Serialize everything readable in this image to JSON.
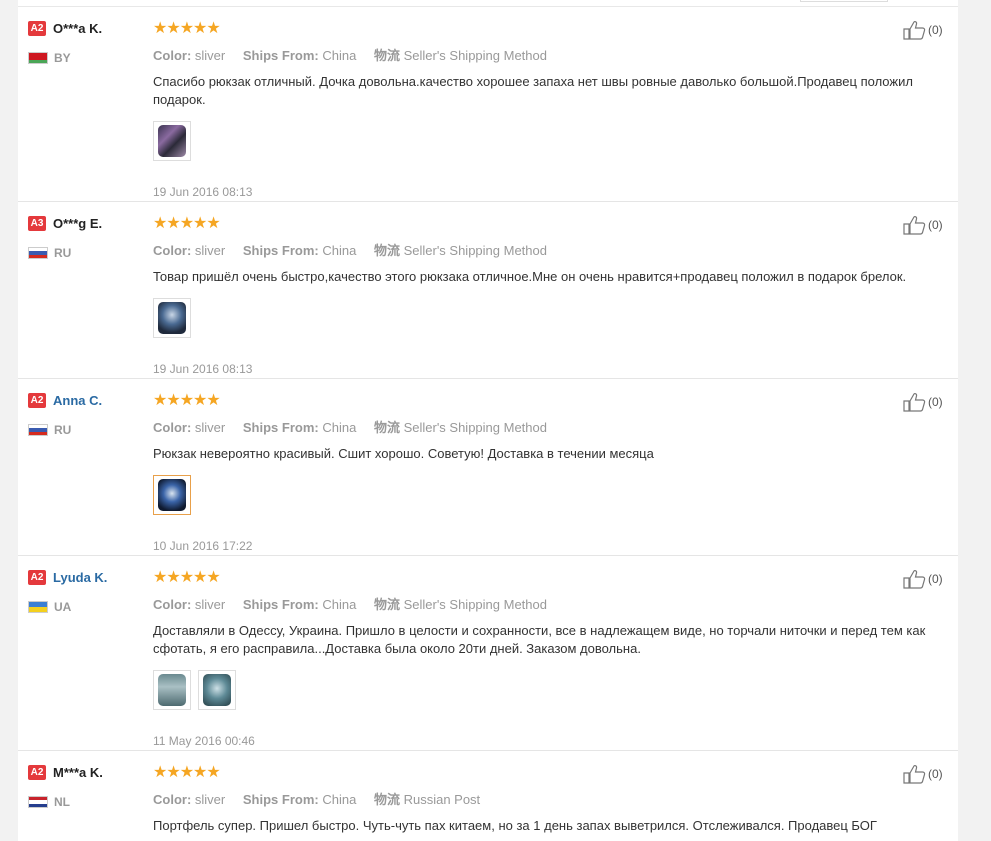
{
  "labels": {
    "color": "Color:",
    "ships_from": "Ships From:",
    "logistics": "物流"
  },
  "reviews": [
    {
      "level": "A2",
      "name": "O***a K.",
      "country": "BY",
      "stars": 5,
      "color": "sliver",
      "ships_from": "China",
      "logistics": "Seller's Shipping Method",
      "text": "Спасибо рюкзак отличный. Дочка довольна.качество хорошее запаха нет швы ровные даволько большой.Продавец положил подарок.",
      "photos": 1,
      "date": "19 Jun 2016 08:13",
      "likes": "(0)"
    },
    {
      "level": "A3",
      "name": "O***g E.",
      "country": "RU",
      "stars": 5,
      "color": "sliver",
      "ships_from": "China",
      "logistics": "Seller's Shipping Method",
      "text": "Товар пришёл очень быстро,качество этого рюкзака отличное.Мне он очень нравится+продавец положил в подарок брелок.",
      "photos": 1,
      "date": "19 Jun 2016 08:13",
      "likes": "(0)"
    },
    {
      "level": "A2",
      "name": "Anna C.",
      "country": "RU",
      "stars": 5,
      "color": "sliver",
      "ships_from": "China",
      "logistics": "Seller's Shipping Method",
      "text": "Рюкзак невероятно красивый. Сшит хорошо. Советую! Доставка в течении месяца",
      "photos": 1,
      "date": "10 Jun 2016 17:22",
      "likes": "(0)"
    },
    {
      "level": "A2",
      "name": "Lyuda K.",
      "country": "UA",
      "stars": 5,
      "color": "sliver",
      "ships_from": "China",
      "logistics": "Seller's Shipping Method",
      "text": "Доставляли в Одессу, Украина. Пришло в целости и сохранности, все в надлежащем виде, но торчали ниточки и перед тем как сфотать, я его расправила...Доставка была около 20ти дней. Заказом довольна.",
      "photos": 2,
      "date": "11 May 2016 00:46",
      "likes": "(0)"
    },
    {
      "level": "A2",
      "name": "M***a K.",
      "country": "NL",
      "stars": 5,
      "color": "sliver",
      "ships_from": "China",
      "logistics": "Russian Post",
      "text": "Портфель супер. Пришел быстро. Чуть-чуть пах китаем, но за 1 день запах выветрился. Отслеживался. Продавец БОГ",
      "photos": 0,
      "date": "",
      "likes": "(0)"
    }
  ]
}
